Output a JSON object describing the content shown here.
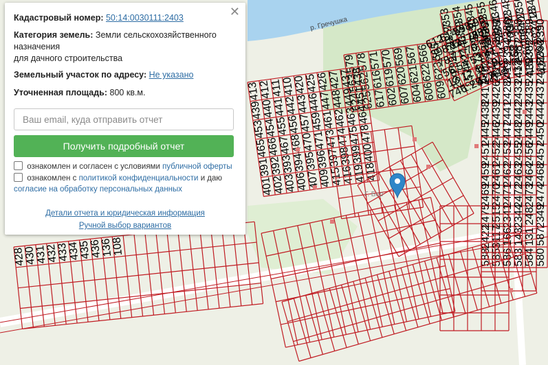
{
  "map": {
    "river_label": "р. Гречушка",
    "street_label": "Г. Бор",
    "parcel_labels": [
      "2353",
      "2354",
      "2345",
      "2355",
      "2346",
      "2348",
      "2356",
      "2349",
      "2357",
      "2359",
      "2350",
      "2360",
      "2351",
      "2352",
      "2407",
      "2418",
      "2429",
      "2440",
      "2385",
      "2396",
      "2335",
      "152700/2",
      "296",
      "283",
      "289",
      "442",
      "273",
      "271",
      "270",
      "268",
      "266",
      "262",
      "259",
      "257",
      "256",
      "261",
      "260",
      "432",
      "430",
      "427",
      "429",
      "2384",
      "2386",
      "2388",
      "2389",
      "2390",
      "2392",
      "2403",
      "2394",
      "2387",
      "2382",
      "2393",
      "2404",
      "2411",
      "2412",
      "2413",
      "2415",
      "2416",
      "2417",
      "2426",
      "2428",
      "2433",
      "2435",
      "2437",
      "2438",
      "2439",
      "2441",
      "2442",
      "2443",
      "2444",
      "2445",
      "2446",
      "2447",
      "2448",
      "2449",
      "2450",
      "2451",
      "2452",
      "2453",
      "2455",
      "2456",
      "2457",
      "2459",
      "2461",
      "2462",
      "2463",
      "2464",
      "2468",
      "2469",
      "2470",
      "2471",
      "2472",
      "2473",
      "2474",
      "2475",
      "2515",
      "2341",
      "2344",
      "248",
      "2349",
      "2422",
      "3117",
      "166",
      "143",
      "131",
      "587",
      "588",
      "585",
      "586",
      "583",
      "584",
      "580",
      "579",
      "578",
      "571",
      "570",
      "569",
      "567",
      "566",
      "565",
      "563",
      "562",
      "616",
      "619",
      "620",
      "621",
      "622",
      "623",
      "624",
      "625",
      "617",
      "602",
      "607",
      "604",
      "606",
      "609",
      "612",
      "614",
      "598",
      "595",
      "398",
      "76",
      "132785",
      "785",
      "78",
      "71",
      "70",
      "55",
      "56",
      "54",
      "53",
      "41",
      "13",
      "12",
      "11",
      "9",
      "746",
      "1:29",
      "417",
      "414",
      "413",
      "412",
      "411",
      "410",
      "420",
      "425",
      "426",
      "427",
      "437",
      "438",
      "439",
      "440",
      "441",
      "442",
      "443",
      "446",
      "447",
      "448",
      "449",
      "451",
      "453",
      "454",
      "455",
      "456",
      "457",
      "459",
      "461",
      "462",
      "463",
      "464",
      "465",
      "466",
      "467",
      "468",
      "470",
      "471",
      "473",
      "474",
      "475",
      "478",
      "391",
      "392",
      "393",
      "394",
      "395",
      "396",
      "397",
      "398",
      "399",
      "400",
      "401",
      "402",
      "403",
      "406",
      "407",
      "409",
      "415",
      "416",
      "419",
      "418",
      "428",
      "430",
      "431",
      "432",
      "433",
      "434",
      "435",
      "436",
      "136",
      "108"
    ]
  },
  "panel": {
    "close": "✕",
    "cadastral_label": "Кадастровый номер:",
    "cadastral_value": "50:14:0030111:2403",
    "category_label": "Категория земель:",
    "category_line1": "Земли сельскохозяйственного",
    "category_line2": "назначения",
    "category_line3": "для дачного строительства",
    "address_label": "Земельный участок по адресу:",
    "address_value": "Не указано",
    "area_label": "Уточненная площадь:",
    "area_value": "800 кв.м.",
    "email_placeholder": "Ваш email, куда отправить отчет",
    "submit_label": "Получить подробный отчет",
    "consent1_text": "ознакомлен и согласен с условиями",
    "consent1_link": "публичной оферты",
    "consent2_text": "ознакомлен с",
    "consent2_link": "политикой конфиденциальности",
    "consent2_text2": "и даю",
    "consent2_link2": "согласие на обработку персональных данных",
    "details_link": "Детали отчета и юридическая информация",
    "manual_link": "Ручной выбор вариантов"
  },
  "colors": {
    "parcel": "#c01b22",
    "river": "#a9d3ef",
    "forest": "#d5e8c8",
    "button": "#52b256",
    "marker": "#2e86c8"
  }
}
